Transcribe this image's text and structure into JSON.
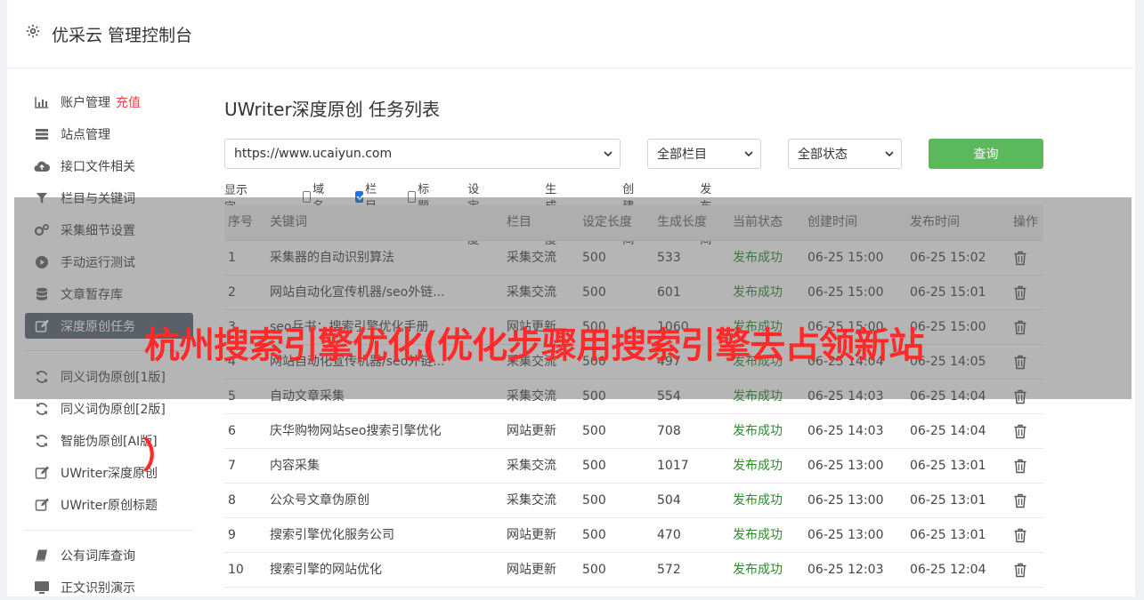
{
  "header": {
    "title": "优采云 管理控制台"
  },
  "sidebar": {
    "recharge_badge": "充值",
    "items": [
      {
        "label": "账户管理",
        "icon": "bar-chart-icon"
      },
      {
        "label": "站点管理",
        "icon": "server-icon"
      },
      {
        "label": "接口文件相关",
        "icon": "cloud-upload-icon"
      },
      {
        "label": "栏目与关键词",
        "icon": "filter-icon"
      },
      {
        "label": "采集细节设置",
        "icon": "cogs-icon"
      },
      {
        "label": "手动运行测试",
        "icon": "play-circle-icon"
      },
      {
        "label": "文章暂存库",
        "icon": "database-icon"
      },
      {
        "label": "深度原创任务",
        "icon": "edit-icon"
      },
      {
        "label": "同义词伪原创[1版]",
        "icon": "refresh-icon"
      },
      {
        "label": "同义词伪原创[2版]",
        "icon": "refresh-icon"
      },
      {
        "label": "智能伪原创[AI版]",
        "icon": "refresh-icon"
      },
      {
        "label": "UWriter深度原创",
        "icon": "edit-icon"
      },
      {
        "label": "UWriter原创标题",
        "icon": "edit-icon"
      },
      {
        "label": "公有词库查询",
        "icon": "book-icon"
      },
      {
        "label": "正文识别演示",
        "icon": "monitor-icon"
      }
    ]
  },
  "main": {
    "title": "UWriter深度原创 任务列表",
    "site_select": "https://www.ucaiyun.com",
    "column_select": "全部栏目",
    "status_select": "全部状态",
    "query_label": "查询",
    "fields_label": "显示字段：",
    "fields": [
      {
        "label": "域名",
        "checked": false
      },
      {
        "label": "栏目",
        "checked": true
      },
      {
        "label": "标题",
        "checked": false
      },
      {
        "label": "设定长度",
        "checked": true
      },
      {
        "label": "生成长度",
        "checked": true
      },
      {
        "label": "创建时间",
        "checked": true
      },
      {
        "label": "发布时间",
        "checked": true
      }
    ]
  },
  "table": {
    "columns": [
      "序号",
      "关键词",
      "栏目",
      "设定长度",
      "生成长度",
      "当前状态",
      "创建时间",
      "发布时间",
      "操作"
    ],
    "rows": [
      [
        "1",
        "采集器的自动识别算法",
        "采集交流",
        "500",
        "533",
        "发布成功",
        "06-25 15:00",
        "06-25 15:02"
      ],
      [
        "2",
        "网站自动化宣传机器/seo外链...",
        "采集交流",
        "500",
        "601",
        "发布成功",
        "06-25 15:00",
        "06-25 15:01"
      ],
      [
        "3",
        "seo兵书：搜索引擎优化手册",
        "网站更新",
        "500",
        "1060",
        "发布成功",
        "06-25 15:00",
        "06-25 15:00"
      ],
      [
        "4",
        "网站自动化宣传机器/seo外链...",
        "采集交流",
        "500",
        "497",
        "发布成功",
        "06-25 14:04",
        "06-25 14:05"
      ],
      [
        "5",
        "自动文章采集",
        "采集交流",
        "500",
        "554",
        "发布成功",
        "06-25 14:03",
        "06-25 14:04"
      ],
      [
        "6",
        "庆华购物网站seo搜索引擎优化",
        "网站更新",
        "500",
        "708",
        "发布成功",
        "06-25 14:03",
        "06-25 14:04"
      ],
      [
        "7",
        "内容采集",
        "采集交流",
        "500",
        "1017",
        "发布成功",
        "06-25 13:00",
        "06-25 13:01"
      ],
      [
        "8",
        "公众号文章伪原创",
        "采集交流",
        "500",
        "504",
        "发布成功",
        "06-25 13:00",
        "06-25 13:01"
      ],
      [
        "9",
        "搜索引擎优化服务公司",
        "网站更新",
        "500",
        "470",
        "发布成功",
        "06-25 13:00",
        "06-25 13:01"
      ],
      [
        "10",
        "搜索引擎的网站优化",
        "网站更新",
        "500",
        "572",
        "发布成功",
        "06-25 12:03",
        "06-25 12:04"
      ]
    ]
  },
  "overlay": {
    "headline": "杭州搜索引擎优化(优化步骤用搜索引擎去占领新站",
    "tail": "）"
  }
}
